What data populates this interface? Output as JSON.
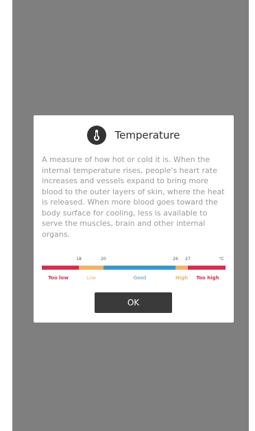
{
  "dialog": {
    "title": "Temperature",
    "icon": "thermometer-icon",
    "description": "A measure of how hot or cold it is. When the internal temperature rises, people's heart rate increases and vessels expand to bring more blood to the outer layers of skin, where the heat is released. When more blood goes toward the body surface for cooling, less is available to serve the muscles, brain and other internal organs.",
    "ok_label": "OK"
  },
  "scale": {
    "unit": "°C",
    "ticks": [
      "18",
      "20",
      "26",
      "27"
    ],
    "bands": [
      {
        "label": "Too low",
        "color": "#d3304d"
      },
      {
        "label": "Low",
        "color": "#f0b26c"
      },
      {
        "label": "Good",
        "color": "#3a97c9"
      },
      {
        "label": "High",
        "color": "#f0b26c"
      },
      {
        "label": "Too high",
        "color": "#d3304d"
      }
    ]
  },
  "colors": {
    "overlay": "#7f7f7f",
    "button": "#3a3a3a"
  }
}
